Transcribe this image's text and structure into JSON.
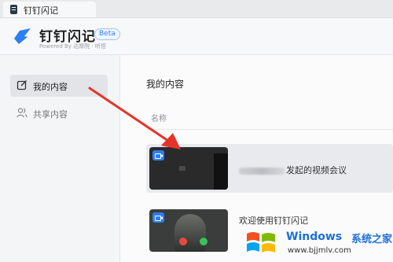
{
  "tab": {
    "label": "钉钉闪记"
  },
  "header": {
    "title": "钉钉闪记",
    "badge": "Beta",
    "powered_by": "Powered By 达摩院 · 听悟"
  },
  "sidebar": {
    "items": [
      {
        "label": "我的内容",
        "icon": "edit-icon",
        "active": true
      },
      {
        "label": "共享内容",
        "icon": "users-icon",
        "active": false
      }
    ]
  },
  "main": {
    "section_title": "我的内容",
    "column_header": "名称",
    "rows": [
      {
        "title": "发起的视频会议",
        "icon": "video-icon"
      },
      {
        "title": "欢迎使用钉钉闪记",
        "icon": "video-icon"
      }
    ]
  },
  "watermark": {
    "brand": "Windows",
    "suffix": "系统之家",
    "url": "www.bjjmlv.com"
  },
  "colors": {
    "accent": "#2d7ef7",
    "arrow": "#e5332a"
  }
}
